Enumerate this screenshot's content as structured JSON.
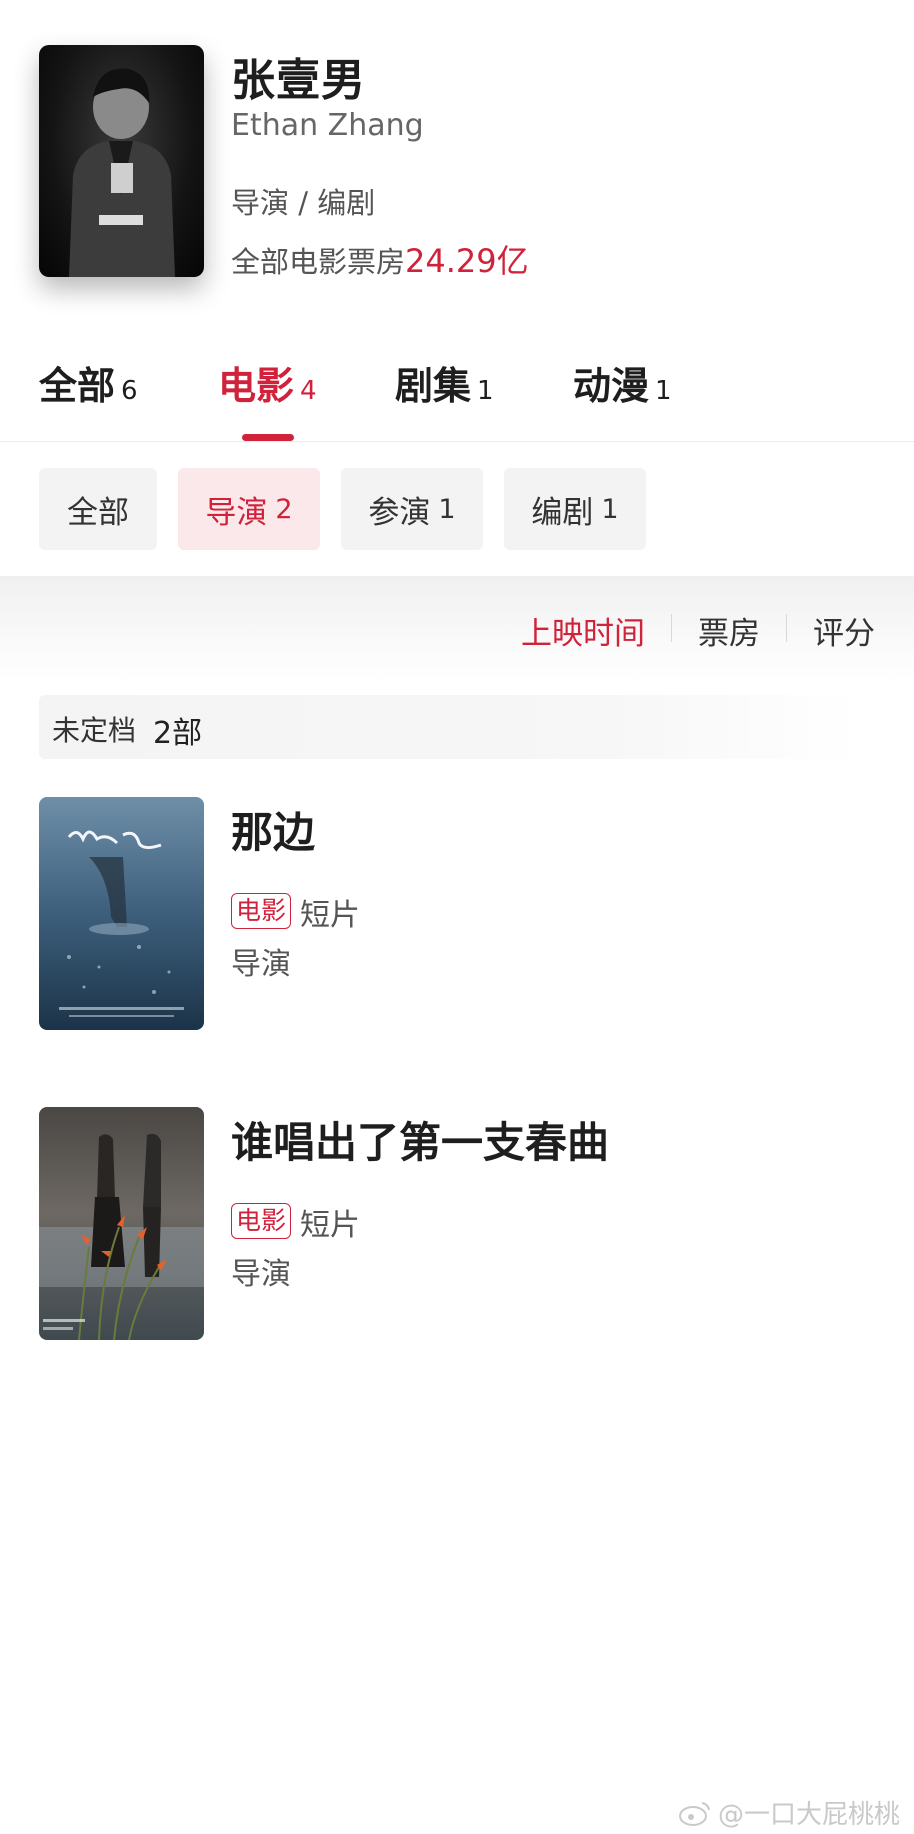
{
  "profile": {
    "name_cn": "张壹男",
    "name_en": "Ethan Zhang",
    "roles": "导演 / 编剧",
    "box_office_label": "全部电影票房",
    "box_office_value": "24.29亿"
  },
  "tabs": [
    {
      "label": "全部",
      "count": "6"
    },
    {
      "label": "电影",
      "count": "4",
      "active": true
    },
    {
      "label": "剧集",
      "count": "1"
    },
    {
      "label": "动漫",
      "count": "1"
    }
  ],
  "chips": [
    {
      "label": "全部",
      "count": ""
    },
    {
      "label": "导演",
      "count": "2",
      "active": true
    },
    {
      "label": "参演",
      "count": "1"
    },
    {
      "label": "编剧",
      "count": "1"
    }
  ],
  "sort": [
    {
      "label": "上映时间",
      "active": true
    },
    {
      "label": "票房"
    },
    {
      "label": "评分"
    }
  ],
  "group": {
    "label": "未定档",
    "count": "2部"
  },
  "movies": [
    {
      "title": "那边",
      "tag": "电影",
      "genre": "短片",
      "role": "导演",
      "poster_icon": "poster-rain-icon"
    },
    {
      "title": "谁唱出了第一支春曲",
      "tag": "电影",
      "genre": "短片",
      "role": "导演",
      "poster_icon": "poster-flowers-icon"
    }
  ],
  "watermark": "@一口大屁桃桃",
  "colors": {
    "accent": "#d0223b",
    "chip_active_bg": "#fbe8ea",
    "chip_bg": "#f3f3f3"
  }
}
